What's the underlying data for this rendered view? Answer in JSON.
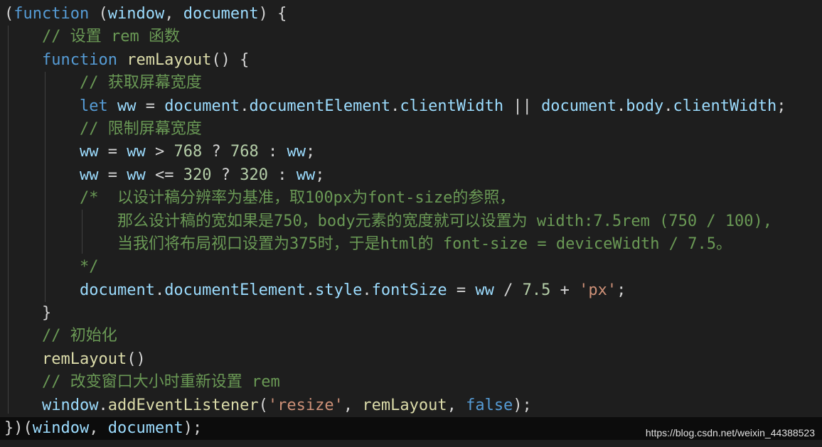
{
  "watermark": "https://blog.csdn.net/weixin_44388523",
  "colors": {
    "background": "#1e1e1e",
    "keyword": "#569cd6",
    "variable": "#9cdcfe",
    "function": "#dcdcaa",
    "number": "#b5cea8",
    "string": "#ce9178",
    "comment": "#6a9955",
    "plain": "#d4d4d4"
  },
  "lines": [
    [
      [
        "pl",
        "("
      ],
      [
        "kw",
        "function"
      ],
      [
        "pl",
        " ("
      ],
      [
        "id",
        "window"
      ],
      [
        "pl",
        ", "
      ],
      [
        "id",
        "document"
      ],
      [
        "pl",
        ") {"
      ]
    ],
    [
      [
        "pl",
        "    "
      ],
      [
        "cm",
        "// 设置 rem 函数"
      ]
    ],
    [
      [
        "pl",
        "    "
      ],
      [
        "kw",
        "function"
      ],
      [
        "pl",
        " "
      ],
      [
        "fn",
        "remLayout"
      ],
      [
        "pl",
        "() {"
      ]
    ],
    [
      [
        "pl",
        "        "
      ],
      [
        "cm",
        "// 获取屏幕宽度"
      ]
    ],
    [
      [
        "pl",
        "        "
      ],
      [
        "kw",
        "let"
      ],
      [
        "pl",
        " "
      ],
      [
        "id",
        "ww"
      ],
      [
        "pl",
        " = "
      ],
      [
        "id",
        "document"
      ],
      [
        "pl",
        "."
      ],
      [
        "id",
        "documentElement"
      ],
      [
        "pl",
        "."
      ],
      [
        "id",
        "clientWidth"
      ],
      [
        "pl",
        " || "
      ],
      [
        "id",
        "document"
      ],
      [
        "pl",
        "."
      ],
      [
        "id",
        "body"
      ],
      [
        "pl",
        "."
      ],
      [
        "id",
        "clientWidth"
      ],
      [
        "pl",
        ";"
      ]
    ],
    [
      [
        "pl",
        "        "
      ],
      [
        "cm",
        "// 限制屏幕宽度"
      ]
    ],
    [
      [
        "pl",
        "        "
      ],
      [
        "id",
        "ww"
      ],
      [
        "pl",
        " = "
      ],
      [
        "id",
        "ww"
      ],
      [
        "pl",
        " > "
      ],
      [
        "num",
        "768"
      ],
      [
        "pl",
        " ? "
      ],
      [
        "num",
        "768"
      ],
      [
        "pl",
        " : "
      ],
      [
        "id",
        "ww"
      ],
      [
        "pl",
        ";"
      ]
    ],
    [
      [
        "pl",
        "        "
      ],
      [
        "id",
        "ww"
      ],
      [
        "pl",
        " = "
      ],
      [
        "id",
        "ww"
      ],
      [
        "pl",
        " <= "
      ],
      [
        "num",
        "320"
      ],
      [
        "pl",
        " ? "
      ],
      [
        "num",
        "320"
      ],
      [
        "pl",
        " : "
      ],
      [
        "id",
        "ww"
      ],
      [
        "pl",
        ";"
      ]
    ],
    [
      [
        "pl",
        "        "
      ],
      [
        "cm",
        "/*  以设计稿分辨率为基准，取100px为font-size的参照，"
      ]
    ],
    [
      [
        "pl",
        "        "
      ],
      [
        "cm",
        "    那么设计稿的宽如果是750，body元素的宽度就可以设置为 width:7.5rem (750 / 100),"
      ]
    ],
    [
      [
        "pl",
        "        "
      ],
      [
        "cm",
        "    当我们将布局视口设置为375时，于是html的 font-size = deviceWidth / 7.5。"
      ]
    ],
    [
      [
        "pl",
        "        "
      ],
      [
        "cm",
        "*/"
      ]
    ],
    [
      [
        "pl",
        "        "
      ],
      [
        "id",
        "document"
      ],
      [
        "pl",
        "."
      ],
      [
        "id",
        "documentElement"
      ],
      [
        "pl",
        "."
      ],
      [
        "id",
        "style"
      ],
      [
        "pl",
        "."
      ],
      [
        "id",
        "fontSize"
      ],
      [
        "pl",
        " = "
      ],
      [
        "id",
        "ww"
      ],
      [
        "pl",
        " / "
      ],
      [
        "num",
        "7.5"
      ],
      [
        "pl",
        " + "
      ],
      [
        "str",
        "'px'"
      ],
      [
        "pl",
        ";"
      ]
    ],
    [
      [
        "pl",
        "    }"
      ]
    ],
    [
      [
        "pl",
        "    "
      ],
      [
        "cm",
        "// 初始化"
      ]
    ],
    [
      [
        "pl",
        "    "
      ],
      [
        "fn",
        "remLayout"
      ],
      [
        "pl",
        "()"
      ]
    ],
    [
      [
        "pl",
        "    "
      ],
      [
        "cm",
        "// 改变窗口大小时重新设置 rem"
      ]
    ],
    [
      [
        "pl",
        "    "
      ],
      [
        "id",
        "window"
      ],
      [
        "pl",
        "."
      ],
      [
        "fn",
        "addEventListener"
      ],
      [
        "pl",
        "("
      ],
      [
        "str",
        "'resize'"
      ],
      [
        "pl",
        ", "
      ],
      [
        "fn",
        "remLayout"
      ],
      [
        "pl",
        ", "
      ],
      [
        "kw",
        "false"
      ],
      [
        "pl",
        ");"
      ]
    ],
    [
      [
        "pl",
        "})("
      ],
      [
        "id",
        "window"
      ],
      [
        "pl",
        ", "
      ],
      [
        "id",
        "document"
      ],
      [
        "pl",
        ");"
      ]
    ]
  ]
}
